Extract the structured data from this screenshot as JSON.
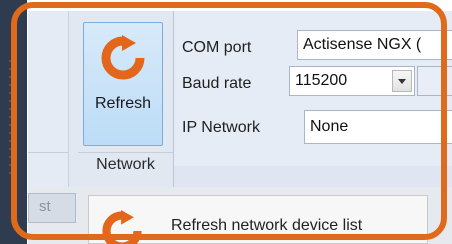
{
  "ribbon": {
    "refresh_button": {
      "label": "Refresh",
      "icon": "refresh-icon"
    },
    "group_label": "Network"
  },
  "fields": {
    "com_port": {
      "label": "COM port",
      "value": "Actisense NGX ("
    },
    "baud_rate": {
      "label": "Baud rate",
      "value": "115200"
    },
    "ip_network": {
      "label": "IP Network",
      "value": "None"
    }
  },
  "bottom": {
    "tab_text": "st",
    "tooltip_text": "Refresh network device list"
  },
  "colors": {
    "highlight_frame": "#e06a1c",
    "refresh_icon": "#e2661c",
    "button_selected": "#bcdcf7"
  }
}
